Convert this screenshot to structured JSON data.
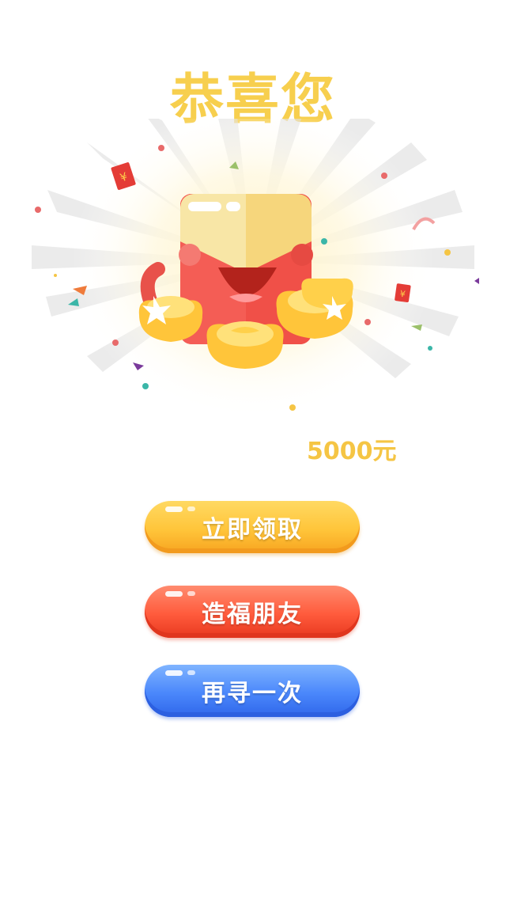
{
  "title": "恭喜您",
  "amount": "5000元",
  "buttons": {
    "claim": "立即领取",
    "share": "造福朋友",
    "again": "再寻一次"
  },
  "colors": {
    "title": "#f7cf4e",
    "amount": "#f5c544",
    "claim": "#ffc53a",
    "share": "#ff5b3c",
    "again": "#4a87fb",
    "envelope": "#f05048",
    "gold": "#ffd04a"
  },
  "decorations": {
    "envelope_symbol": "¥"
  }
}
